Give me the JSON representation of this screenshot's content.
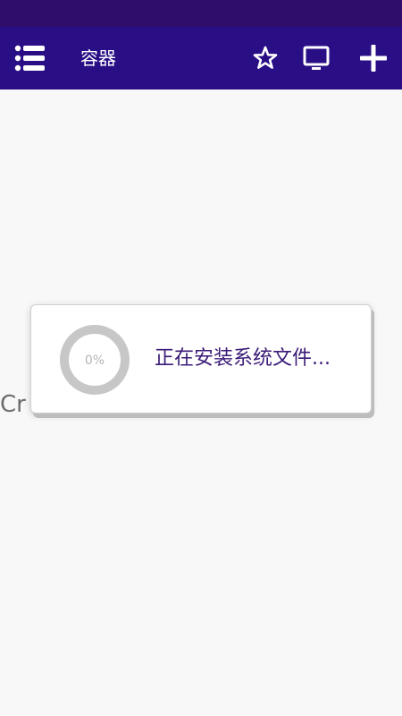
{
  "app_bar": {
    "title": "容器",
    "icons": {
      "menu": "list-menu-icon",
      "favorite": "star-icon",
      "display": "monitor-icon",
      "add": "plus-icon"
    }
  },
  "main": {
    "empty_text": "Cr                           g     d!"
  },
  "dialog": {
    "progress_text": "0%",
    "progress_value": 0,
    "message": "正在安装系统文件..."
  },
  "colors": {
    "status_bar": "#2f0e6a",
    "app_bar": "#290e85",
    "accent_text": "#3a1a78",
    "progress_track": "#c7c7c7",
    "background": "#f8f8f8"
  }
}
